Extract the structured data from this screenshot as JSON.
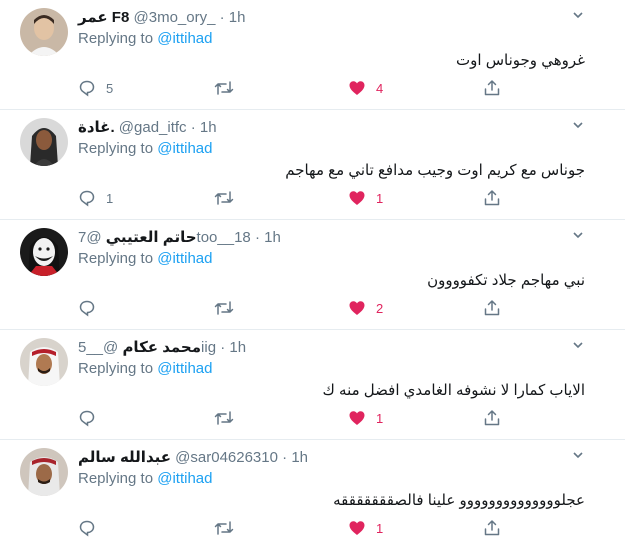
{
  "reply_prefix": "Replying to",
  "replying_to": "@ittihad",
  "colors": {
    "accent": "#1da1f2",
    "like": "#e0245e",
    "muted": "#657786",
    "border": "#e6ecf0"
  },
  "tweets": [
    {
      "name": "عمر F8",
      "handle": "@3mo_ory_",
      "dot": "·",
      "time": "1h",
      "text": "غروهي وجوناس اوت",
      "replies": "5",
      "likes": "4"
    },
    {
      "name": "غادة.",
      "handle": "@gad_itfc",
      "dot": "·",
      "time": "1h",
      "text": "جوناس مع كريم اوت وجيب مدافع تاني مع مهاجم",
      "replies": "1",
      "likes": "1"
    },
    {
      "name": "حاتم العتيبي",
      "handle": "@7too__18",
      "dot": "·",
      "time": "1h",
      "text": "نبي مهاجم جلاد تكفوووون",
      "replies": "",
      "likes": "2"
    },
    {
      "name": "محمد عكام",
      "handle": "@__5iig",
      "dot": "·",
      "time": "1h",
      "text": "الاياب كمارا  لا نشوفه الغامدي افضل منه ك",
      "replies": "",
      "likes": "1"
    },
    {
      "name": "عبدالله سالم",
      "handle": "@sar04626310",
      "dot": "·",
      "time": "1h",
      "text": "عجلوووووووووووووو علينا فالصقققققققه",
      "replies": "",
      "likes": "1"
    }
  ],
  "icons": [
    "reply-icon",
    "retweet-icon",
    "like-icon",
    "share-icon",
    "caret-down-icon"
  ]
}
